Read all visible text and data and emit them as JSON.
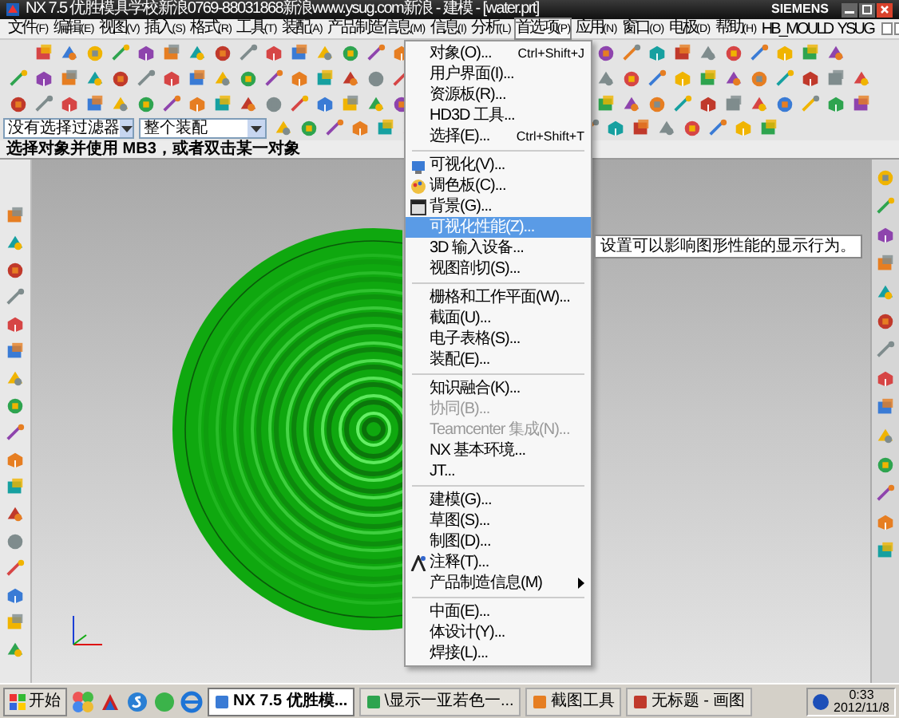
{
  "window": {
    "title": "NX 7.5 优胜模具学校新浪0769-88031868新浪www.ysug.com新浪 - 建模 - [water.prt]",
    "brand": "SIEMENS"
  },
  "menu_bar": [
    {
      "label": "文件(F)",
      "selected": false
    },
    {
      "label": "编辑(E)",
      "selected": false
    },
    {
      "label": "视图(V)",
      "selected": false
    },
    {
      "label": "插入(S)",
      "selected": false
    },
    {
      "label": "格式(R)",
      "selected": false
    },
    {
      "label": "工具(T)",
      "selected": false
    },
    {
      "label": "装配(A)",
      "selected": false
    },
    {
      "label": "产品制造信息(M)",
      "selected": false
    },
    {
      "label": "信息(I)",
      "selected": false
    },
    {
      "label": "分析(L)",
      "selected": false
    },
    {
      "label": "首选项(P)",
      "selected": true
    },
    {
      "label": "应用(N)",
      "selected": false
    },
    {
      "label": "窗口(O)",
      "selected": false
    },
    {
      "label": "电极(D)",
      "selected": false
    },
    {
      "label": "帮助(H)",
      "selected": false
    },
    {
      "label": "HB_MOULD",
      "selected": false
    },
    {
      "label": "YSUG",
      "selected": false
    }
  ],
  "filters": [
    {
      "value": "没有选择过滤器"
    },
    {
      "value": "整个装配"
    }
  ],
  "status_line": "选择对象并使用 MB3，或者双击某一对象",
  "dropdown_menu": [
    {
      "kind": "item",
      "label": "对象(O)...",
      "shortcut": "Ctrl+Shift+J",
      "selected": false,
      "disabled": false
    },
    {
      "kind": "item",
      "label": "用户界面(I)...",
      "selected": false,
      "disabled": false
    },
    {
      "kind": "item",
      "label": "资源板(R)...",
      "selected": false,
      "disabled": false
    },
    {
      "kind": "item",
      "label": "HD3D 工具...",
      "selected": false,
      "disabled": false
    },
    {
      "kind": "item",
      "label": "选择(E)...",
      "shortcut": "Ctrl+Shift+T",
      "selected": false,
      "disabled": false
    },
    {
      "kind": "separator"
    },
    {
      "kind": "item",
      "label": "可视化(V)...",
      "selected": false,
      "disabled": false,
      "has_icon": true
    },
    {
      "kind": "item",
      "label": "调色板(C)...",
      "selected": false,
      "disabled": false,
      "has_icon": true
    },
    {
      "kind": "item",
      "label": "背景(G)...",
      "selected": false,
      "disabled": false,
      "has_icon": true
    },
    {
      "kind": "item",
      "label": "可视化性能(Z)...",
      "selected": true,
      "disabled": false
    },
    {
      "kind": "item",
      "label": "3D 输入设备...",
      "selected": false,
      "disabled": false
    },
    {
      "kind": "item",
      "label": "视图剖切(S)...",
      "selected": false,
      "disabled": false
    },
    {
      "kind": "separator"
    },
    {
      "kind": "item",
      "label": "栅格和工作平面(W)...",
      "selected": false,
      "disabled": false
    },
    {
      "kind": "item",
      "label": "截面(U)...",
      "selected": false,
      "disabled": false
    },
    {
      "kind": "item",
      "label": "电子表格(S)...",
      "selected": false,
      "disabled": false
    },
    {
      "kind": "item",
      "label": "装配(E)...",
      "selected": false,
      "disabled": false
    },
    {
      "kind": "separator"
    },
    {
      "kind": "item",
      "label": "知识融合(K)...",
      "selected": false,
      "disabled": false
    },
    {
      "kind": "item",
      "label": "协同(B)...",
      "selected": false,
      "disabled": true
    },
    {
      "kind": "item",
      "label": "Teamcenter 集成(N)...",
      "selected": false,
      "disabled": true
    },
    {
      "kind": "item",
      "label": "NX 基本环境...",
      "selected": false,
      "disabled": false
    },
    {
      "kind": "item",
      "label": "JT...",
      "selected": false,
      "disabled": false
    },
    {
      "kind": "separator"
    },
    {
      "kind": "item",
      "label": "建模(G)...",
      "selected": false,
      "disabled": false
    },
    {
      "kind": "item",
      "label": "草图(S)...",
      "selected": false,
      "disabled": false
    },
    {
      "kind": "item",
      "label": "制图(D)...",
      "selected": false,
      "disabled": false
    },
    {
      "kind": "item",
      "label": "注释(T)...",
      "selected": false,
      "disabled": false,
      "has_icon": true
    },
    {
      "kind": "item",
      "label": "产品制造信息(M)",
      "selected": false,
      "disabled": false,
      "submenu": true
    },
    {
      "kind": "separator"
    },
    {
      "kind": "item",
      "label": "中面(E)...",
      "selected": false,
      "disabled": false
    },
    {
      "kind": "item",
      "label": "体设计(Y)...",
      "selected": false,
      "disabled": false
    },
    {
      "kind": "item",
      "label": "焊接(L)...",
      "selected": false,
      "disabled": false
    }
  ],
  "tooltip": "设置可以影响图形性能的显示行为。",
  "taskbar": {
    "start": "开始",
    "tasks": [
      {
        "label": "NX 7.5 优胜模...",
        "selected": true
      },
      {
        "label": "\\显示一亚若色一...",
        "selected": false
      },
      {
        "label": "截图工具",
        "selected": false
      },
      {
        "label": "无标题 - 画图",
        "selected": false
      }
    ],
    "time": "0:33",
    "date": "2012/11/8"
  }
}
